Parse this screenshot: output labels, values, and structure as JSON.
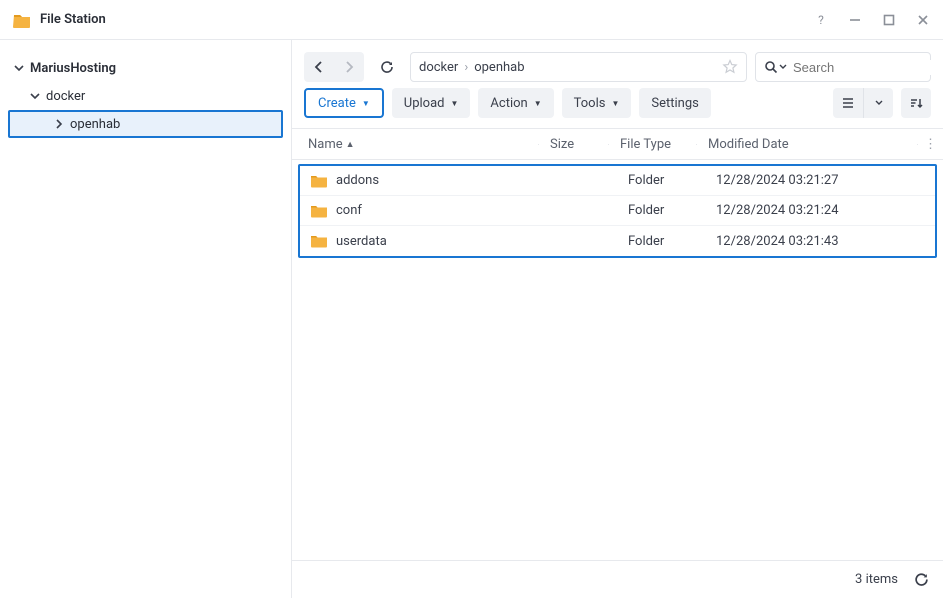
{
  "app": {
    "title": "File Station"
  },
  "tree": {
    "root": "MariusHosting",
    "child1": "docker",
    "child2": "openhab"
  },
  "breadcrumb": {
    "part1": "docker",
    "part2": "openhab"
  },
  "search": {
    "placeholder": "Search"
  },
  "buttons": {
    "create": "Create",
    "upload": "Upload",
    "action": "Action",
    "tools": "Tools",
    "settings": "Settings"
  },
  "columns": {
    "name": "Name",
    "size": "Size",
    "type": "File Type",
    "date": "Modified Date"
  },
  "rows": [
    {
      "name": "addons",
      "size": "",
      "type": "Folder",
      "date": "12/28/2024 03:21:27"
    },
    {
      "name": "conf",
      "size": "",
      "type": "Folder",
      "date": "12/28/2024 03:21:24"
    },
    {
      "name": "userdata",
      "size": "",
      "type": "Folder",
      "date": "12/28/2024 03:21:43"
    }
  ],
  "footer": {
    "count": "3 items"
  }
}
